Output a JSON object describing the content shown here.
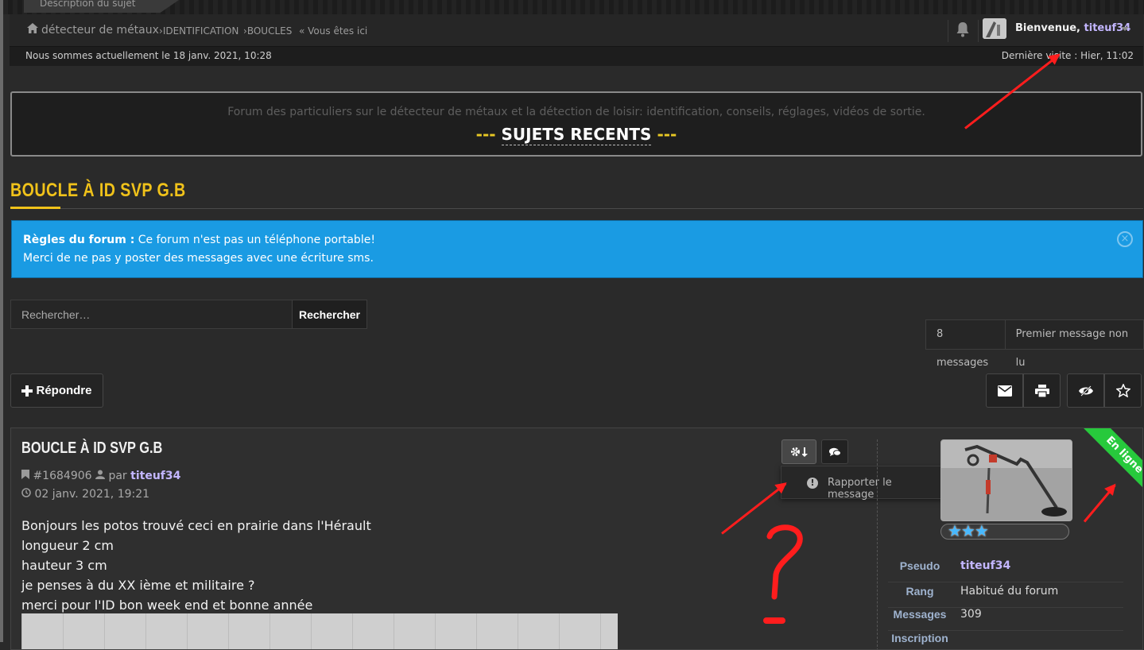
{
  "top_tab": "Description du sujet",
  "breadcrumb": {
    "home": "détecteur de métaux",
    "items": [
      "IDENTIFICATION",
      "BOUCLES"
    ],
    "current": "« Vous êtes ici"
  },
  "user_menu": {
    "welcome": "Bienvenue,",
    "username": "titeuf34"
  },
  "datebar": {
    "now": "Nous sommes actuellement le 18 janv. 2021, 10:28",
    "last_visit": "Dernière visite : Hier, 11:02"
  },
  "banner": {
    "description": "Forum des particuliers sur le détecteur de métaux et la détection de loisir: identification, conseils, réglages, vidéos de sortie.",
    "dash": "---",
    "title": "SUJETS RECENTS"
  },
  "topic_title": "BOUCLE À ID SVP G.B",
  "rules": {
    "label": "Règles du forum :",
    "line1": "Ce forum n'est pas un téléphone portable!",
    "line2": "Merci de ne pas y poster des messages avec une écriture sms."
  },
  "search": {
    "placeholder": "Rechercher…",
    "button": "Rechercher"
  },
  "pagination": {
    "count": "8 messages",
    "first_unread": "Premier message non lu"
  },
  "reply_label": "Répondre",
  "post": {
    "title": "BOUCLE À ID SVP G.B",
    "id": "#1684906",
    "by": "par",
    "author": "titeuf34",
    "date": "02 janv. 2021, 19:21",
    "body": [
      "Bonjours les potos trouvé ceci en prairie dans l'Hérault",
      "longueur 2 cm",
      "hauteur 3 cm",
      "je penses à du XX ième et militaire ?",
      "merci pour l'ID bon week end et bonne année"
    ],
    "report_label": "Rapporter le message",
    "online_label": "En ligne"
  },
  "profile": [
    {
      "key": "Pseudo",
      "value": "titeuf34"
    },
    {
      "key": "Rang",
      "value": "Habitué du forum"
    },
    {
      "key": "Messages",
      "value": "309"
    },
    {
      "key": "Inscription",
      "value": ""
    }
  ],
  "colors": {
    "accent": "#f0c21a",
    "rules_bg": "#1a9be3",
    "username": "#c3b6ff",
    "online": "#27c93c",
    "annotation": "#ff1d1d"
  }
}
